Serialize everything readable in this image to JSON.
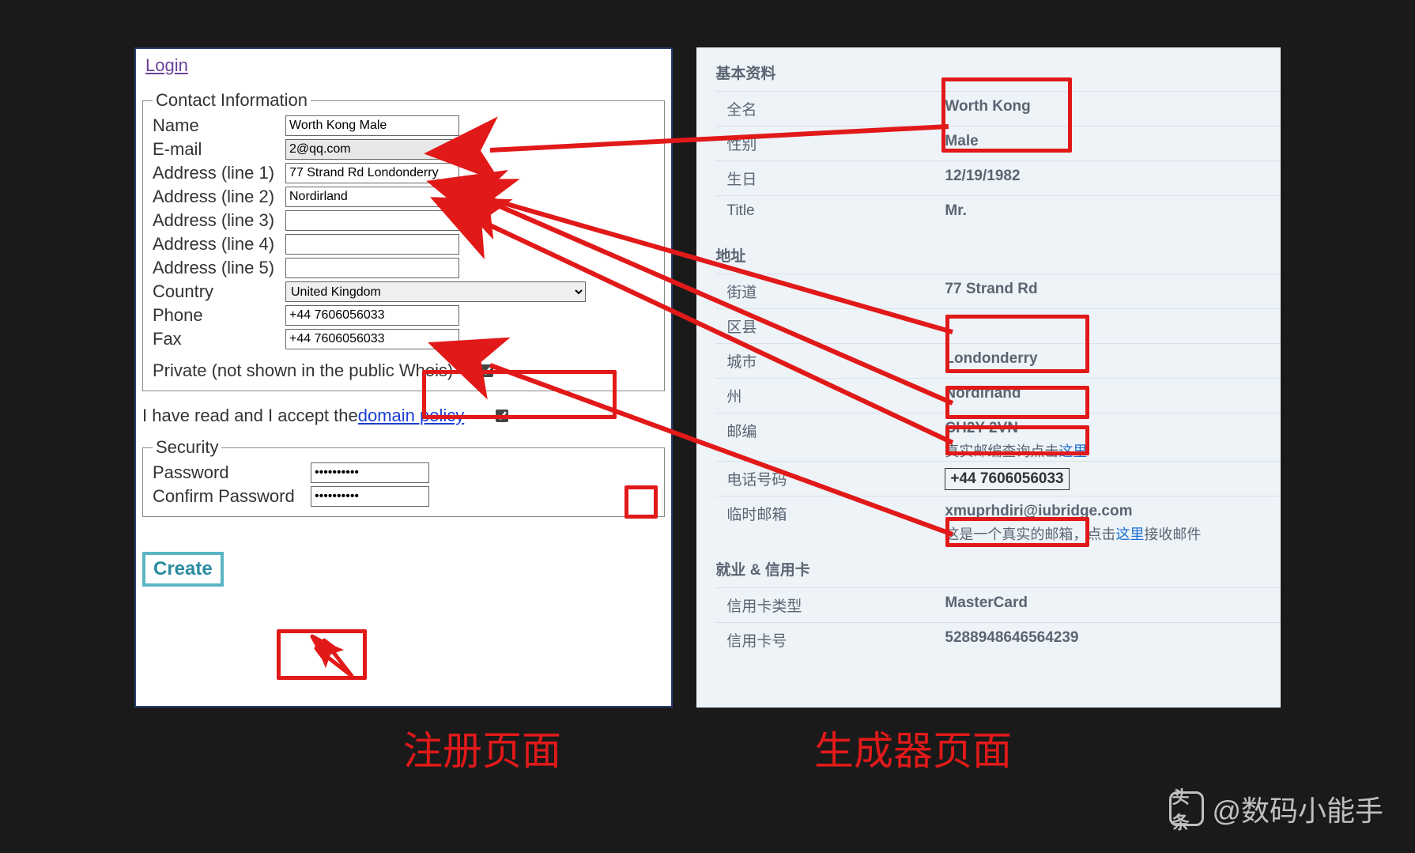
{
  "left": {
    "login_link": "Login",
    "contact_legend": "Contact Information",
    "labels": {
      "name": "Name",
      "email": "E-mail",
      "addr1": "Address (line 1)",
      "addr2": "Address (line 2)",
      "addr3": "Address (line 3)",
      "addr4": "Address (line 4)",
      "addr5": "Address (line 5)",
      "country": "Country",
      "phone": "Phone",
      "fax": "Fax",
      "private": "Private (not shown in the public Whois)",
      "password": "Password",
      "confirm": "Confirm Password"
    },
    "values": {
      "name": "Worth Kong Male",
      "email": "2@qq.com",
      "addr1": "77 Strand Rd Londonderry",
      "addr2": "Nordirland",
      "addr3": "",
      "addr4": "",
      "addr5": "",
      "country": "United Kingdom",
      "phone": "+44 7606056033",
      "fax": "+44 7606056033",
      "password": "••••••••••",
      "confirm": "••••••••••"
    },
    "policy_text_prefix": "I have read and I accept the ",
    "policy_link": "domain policy",
    "security_legend": "Security",
    "create_button": "Create"
  },
  "right": {
    "section_basic": "基本资料",
    "fullname_label": "全名",
    "fullname_value": "Worth Kong",
    "gender_label": "性别",
    "gender_value": "Male",
    "birthday_label": "生日",
    "birthday_value": "12/19/1982",
    "title_label": "Title",
    "title_value": "Mr.",
    "section_address": "地址",
    "street_label": "街道",
    "street_value": "77 Strand Rd",
    "district_label": "区县",
    "district_value": "",
    "city_label": "城市",
    "city_value": "Londonderry",
    "state_label": "州",
    "state_value": "Nordirland",
    "zip_label": "邮编",
    "zip_value": "CH2Y 2VN",
    "zip_sub_prefix": "真实邮编查询点击",
    "zip_sub_link": "这里",
    "phone_label": "电话号码",
    "phone_value": "+44 7606056033",
    "tempmail_label": "临时邮箱",
    "tempmail_value": "xmuprhdiri@iubridge.com",
    "tempmail_sub_prefix": "这是一个真实的邮箱，点击",
    "tempmail_sub_link": "这里",
    "tempmail_sub_suffix": "接收邮件",
    "section_work": "就业 & 信用卡",
    "cardtype_label": "信用卡类型",
    "cardtype_value": "MasterCard",
    "cardnum_label": "信用卡号",
    "cardnum_value": "5288948646564239"
  },
  "captions": {
    "left": "注册页面",
    "right": "生成器页面"
  },
  "watermark": {
    "logo_text": "头条",
    "author": "@数码小能手"
  },
  "colors": {
    "annotation_red": "#e11919",
    "link_blue": "#1a6fd4",
    "generator_bg": "#eef3f8"
  }
}
